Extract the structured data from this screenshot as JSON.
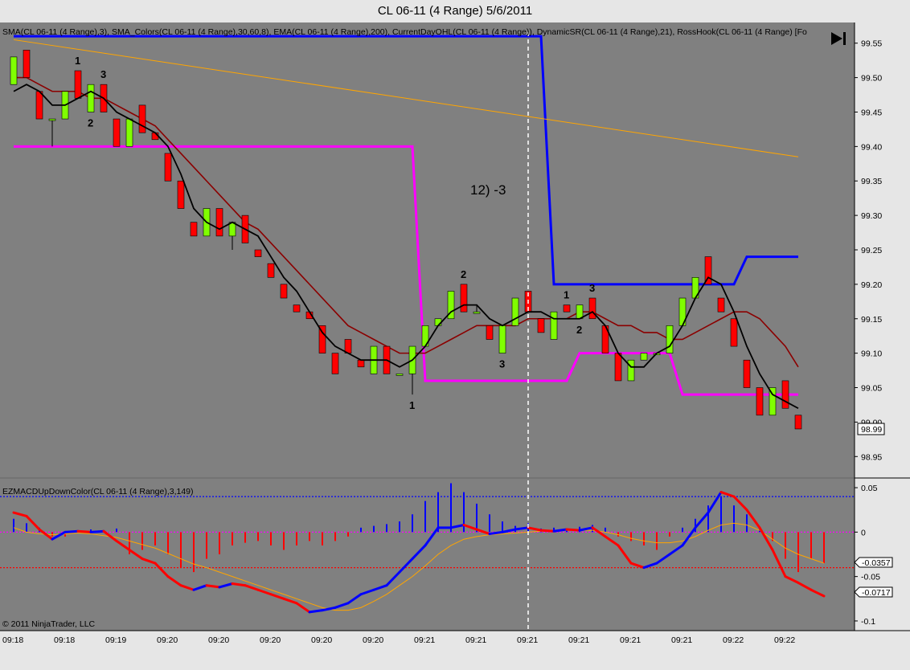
{
  "window": {
    "title": "CL 06-11 (4 Range)  5/6/2011",
    "copyright": "© 2011 NinjaTrader, LLC"
  },
  "price_panel": {
    "indicator_label": "SMA(CL 06-11 (4 Range),3), SMA_Colors(CL 06-11 (4 Range),30,60,8), EMA(CL 06-11 (4 Range),200), CurrentDayOHL(CL 06-11 (4 Range)), DynamicSR(CL 06-11 (4 Range),21), RossHook(CL 06-11 (4 Range) [Fo",
    "annotation": "12) -3",
    "last_price_label": "98.99"
  },
  "macd_panel": {
    "indicator_label": "EZMACDUpDownColor(CL 06-11 (4 Range),3,149)",
    "value_labels": [
      "-0.0357",
      "-0.0717"
    ]
  },
  "colors": {
    "background": "#808080",
    "up_candle": "#80ff00",
    "down_candle": "#ff0000",
    "sma3": "#000000",
    "ema200": "#ffa500",
    "current_day_high": "#0000ff",
    "current_day_low": "#ff00ff",
    "sma_colors_slow": "#8b0000",
    "sma_colors_fast": "#ff0000",
    "sma_colors_flat": "#ffffff",
    "sma_colors_up": "#008000",
    "macd": "#ff0000",
    "macd_up": "#0000ff",
    "signal": "#ffa500"
  },
  "chart_data": [
    {
      "type": "candlestick",
      "ylim": [
        98.92,
        99.58
      ],
      "y_ticks": [
        98.95,
        99.0,
        99.05,
        99.1,
        99.15,
        99.2,
        99.25,
        99.3,
        99.35,
        99.4,
        99.45,
        99.5,
        99.55
      ],
      "x_tick_labels": [
        "09:18",
        "09:18",
        "09:19",
        "09:20",
        "09:20",
        "09:20",
        "09:20",
        "09:20",
        "09:21",
        "09:21",
        "09:21",
        "09:21",
        "09:21",
        "09:21",
        "09:22",
        "09:22"
      ],
      "candles": [
        {
          "o": 99.49,
          "h": 99.53,
          "l": 99.49,
          "c": 99.53
        },
        {
          "o": 99.54,
          "h": 99.54,
          "l": 99.5,
          "c": 99.5
        },
        {
          "o": 99.48,
          "h": 99.48,
          "l": 99.44,
          "c": 99.44
        },
        {
          "o": 99.44,
          "h": 99.44,
          "l": 99.4,
          "c": 99.44
        },
        {
          "o": 99.44,
          "h": 99.48,
          "l": 99.44,
          "c": 99.48
        },
        {
          "o": 99.51,
          "h": 99.51,
          "l": 99.47,
          "c": 99.47
        },
        {
          "o": 99.45,
          "h": 99.49,
          "l": 99.45,
          "c": 99.49
        },
        {
          "o": 99.49,
          "h": 99.49,
          "l": 99.45,
          "c": 99.45
        },
        {
          "o": 99.44,
          "h": 99.44,
          "l": 99.4,
          "c": 99.4
        },
        {
          "o": 99.4,
          "h": 99.44,
          "l": 99.4,
          "c": 99.44
        },
        {
          "o": 99.46,
          "h": 99.46,
          "l": 99.42,
          "c": 99.42
        },
        {
          "o": 99.42,
          "h": 99.42,
          "l": 99.41,
          "c": 99.41
        },
        {
          "o": 99.39,
          "h": 99.39,
          "l": 99.35,
          "c": 99.35
        },
        {
          "o": 99.35,
          "h": 99.35,
          "l": 99.31,
          "c": 99.31
        },
        {
          "o": 99.29,
          "h": 99.29,
          "l": 99.27,
          "c": 99.27
        },
        {
          "o": 99.27,
          "h": 99.31,
          "l": 99.27,
          "c": 99.31
        },
        {
          "o": 99.31,
          "h": 99.31,
          "l": 99.27,
          "c": 99.27
        },
        {
          "o": 99.27,
          "h": 99.29,
          "l": 99.25,
          "c": 99.29
        },
        {
          "o": 99.3,
          "h": 99.3,
          "l": 99.26,
          "c": 99.26
        },
        {
          "o": 99.25,
          "h": 99.25,
          "l": 99.24,
          "c": 99.24
        },
        {
          "o": 99.23,
          "h": 99.23,
          "l": 99.21,
          "c": 99.21
        },
        {
          "o": 99.2,
          "h": 99.2,
          "l": 99.18,
          "c": 99.18
        },
        {
          "o": 99.17,
          "h": 99.17,
          "l": 99.16,
          "c": 99.16
        },
        {
          "o": 99.16,
          "h": 99.16,
          "l": 99.15,
          "c": 99.15
        },
        {
          "o": 99.14,
          "h": 99.14,
          "l": 99.1,
          "c": 99.1
        },
        {
          "o": 99.1,
          "h": 99.1,
          "l": 99.07,
          "c": 99.07
        },
        {
          "o": 99.12,
          "h": 99.12,
          "l": 99.1,
          "c": 99.1
        },
        {
          "o": 99.09,
          "h": 99.09,
          "l": 99.08,
          "c": 99.08
        },
        {
          "o": 99.07,
          "h": 99.11,
          "l": 99.07,
          "c": 99.11
        },
        {
          "o": 99.11,
          "h": 99.11,
          "l": 99.07,
          "c": 99.07
        },
        {
          "o": 99.07,
          "h": 99.07,
          "l": 99.07,
          "c": 99.07
        },
        {
          "o": 99.07,
          "h": 99.11,
          "l": 99.04,
          "c": 99.11
        },
        {
          "o": 99.11,
          "h": 99.14,
          "l": 99.11,
          "c": 99.14
        },
        {
          "o": 99.14,
          "h": 99.15,
          "l": 99.14,
          "c": 99.15
        },
        {
          "o": 99.15,
          "h": 99.19,
          "l": 99.15,
          "c": 99.19
        },
        {
          "o": 99.2,
          "h": 99.2,
          "l": 99.16,
          "c": 99.16
        },
        {
          "o": 99.16,
          "h": 99.17,
          "l": 99.16,
          "c": 99.16
        },
        {
          "o": 99.14,
          "h": 99.14,
          "l": 99.12,
          "c": 99.12
        },
        {
          "o": 99.1,
          "h": 99.14,
          "l": 99.1,
          "c": 99.14
        },
        {
          "o": 99.14,
          "h": 99.18,
          "l": 99.14,
          "c": 99.18
        },
        {
          "o": 99.19,
          "h": 99.19,
          "l": 99.16,
          "c": 99.16
        },
        {
          "o": 99.15,
          "h": 99.15,
          "l": 99.13,
          "c": 99.13
        },
        {
          "o": 99.12,
          "h": 99.16,
          "l": 99.12,
          "c": 99.16
        },
        {
          "o": 99.17,
          "h": 99.17,
          "l": 99.16,
          "c": 99.16
        },
        {
          "o": 99.15,
          "h": 99.17,
          "l": 99.15,
          "c": 99.17
        },
        {
          "o": 99.18,
          "h": 99.18,
          "l": 99.15,
          "c": 99.15
        },
        {
          "o": 99.14,
          "h": 99.14,
          "l": 99.1,
          "c": 99.1
        },
        {
          "o": 99.1,
          "h": 99.1,
          "l": 99.06,
          "c": 99.06
        },
        {
          "o": 99.06,
          "h": 99.09,
          "l": 99.06,
          "c": 99.09
        },
        {
          "o": 99.09,
          "h": 99.1,
          "l": 99.09,
          "c": 99.1
        },
        {
          "o": 99.1,
          "h": 99.1,
          "l": 99.1,
          "c": 99.1
        },
        {
          "o": 99.1,
          "h": 99.14,
          "l": 99.1,
          "c": 99.14
        },
        {
          "o": 99.14,
          "h": 99.18,
          "l": 99.14,
          "c": 99.18
        },
        {
          "o": 99.18,
          "h": 99.21,
          "l": 99.18,
          "c": 99.21
        },
        {
          "o": 99.24,
          "h": 99.24,
          "l": 99.2,
          "c": 99.2
        },
        {
          "o": 99.18,
          "h": 99.18,
          "l": 99.16,
          "c": 99.16
        },
        {
          "o": 99.15,
          "h": 99.15,
          "l": 99.11,
          "c": 99.11
        },
        {
          "o": 99.09,
          "h": 99.09,
          "l": 99.05,
          "c": 99.05
        },
        {
          "o": 99.05,
          "h": 99.05,
          "l": 99.01,
          "c": 99.01
        },
        {
          "o": 99.01,
          "h": 99.05,
          "l": 99.01,
          "c": 99.05
        },
        {
          "o": 99.06,
          "h": 99.06,
          "l": 99.02,
          "c": 99.02
        },
        {
          "o": 99.01,
          "h": 99.01,
          "l": 98.99,
          "c": 98.99
        }
      ],
      "series": [
        {
          "name": "SMA(CL 06-11 (4 Range),3)",
          "values": [
            99.48,
            99.49,
            99.48,
            99.46,
            99.46,
            99.47,
            99.48,
            99.47,
            99.45,
            99.44,
            99.43,
            99.42,
            99.4,
            99.36,
            99.31,
            99.29,
            99.28,
            99.29,
            99.28,
            99.27,
            99.24,
            99.21,
            99.19,
            99.16,
            99.13,
            99.11,
            99.1,
            99.09,
            99.09,
            99.09,
            99.08,
            99.09,
            99.11,
            99.14,
            99.16,
            99.17,
            99.17,
            99.15,
            99.14,
            99.15,
            99.16,
            99.16,
            99.15,
            99.15,
            99.15,
            99.16,
            99.14,
            99.1,
            99.08,
            99.08,
            99.1,
            99.11,
            99.14,
            99.18,
            99.21,
            99.2,
            99.16,
            99.11,
            99.07,
            99.04,
            99.03,
            99.02
          ]
        },
        {
          "name": "EMA(CL 06-11 (4 Range),200)",
          "x_end": 61,
          "values_start": 99.555,
          "values_end": 99.385
        },
        {
          "name": "SMA_Colors slow",
          "values": [
            99.5,
            99.5,
            99.49,
            99.48,
            99.48,
            99.48,
            99.47,
            99.47,
            99.46,
            99.45,
            99.44,
            99.43,
            99.41,
            99.39,
            99.37,
            99.35,
            99.33,
            99.31,
            99.29,
            99.28,
            99.26,
            99.24,
            99.22,
            99.2,
            99.18,
            99.16,
            99.14,
            99.13,
            99.12,
            99.11,
            99.1,
            99.1,
            99.1,
            99.11,
            99.12,
            99.13,
            99.14,
            99.14,
            99.14,
            99.14,
            99.15,
            99.15,
            99.15,
            99.15,
            99.16,
            99.16,
            99.15,
            99.14,
            99.14,
            99.13,
            99.13,
            99.12,
            99.12,
            99.13,
            99.14,
            99.15,
            99.16,
            99.16,
            99.15,
            99.13,
            99.11,
            99.08
          ]
        },
        {
          "name": "CurrentDayOHL high",
          "segments": [
            [
              0,
              99.56
            ],
            [
              40,
              99.56
            ],
            [
              41,
              99.56
            ],
            [
              42,
              99.2
            ],
            [
              56,
              99.2
            ],
            [
              57,
              99.24
            ],
            [
              61,
              99.24
            ]
          ]
        },
        {
          "name": "CurrentDayOHL low",
          "segments": [
            [
              0,
              99.4
            ],
            [
              31,
              99.4
            ],
            [
              32,
              99.06
            ],
            [
              42,
              99.06
            ],
            [
              43,
              99.06
            ],
            [
              44,
              99.1
            ],
            [
              51,
              99.1
            ],
            [
              52,
              99.04
            ],
            [
              61,
              99.04
            ]
          ]
        }
      ],
      "swing_labels": [
        {
          "bar": 5,
          "text": "1",
          "pos": "above"
        },
        {
          "bar": 7,
          "text": "3",
          "pos": "above"
        },
        {
          "bar": 6,
          "text": "2",
          "pos": "below"
        },
        {
          "bar": 31,
          "text": "1",
          "pos": "below"
        },
        {
          "bar": 35,
          "text": "2",
          "pos": "above"
        },
        {
          "bar": 38,
          "text": "3",
          "pos": "below"
        },
        {
          "bar": 43,
          "text": "1",
          "pos": "above"
        },
        {
          "bar": 45,
          "text": "3",
          "pos": "above"
        },
        {
          "bar": 44,
          "text": "2",
          "pos": "below"
        }
      ]
    },
    {
      "type": "bar+line",
      "ylim": [
        -0.11,
        0.06
      ],
      "y_ticks": [
        0.05,
        0,
        -0.05,
        -0.1
      ],
      "y_tick_labels": [
        "0.05",
        "0",
        "-0.05",
        "-0.1"
      ],
      "hlines": [
        {
          "value": 0.04,
          "color": "#0000ff"
        },
        {
          "value": 0.0,
          "color": "#ff00ff"
        },
        {
          "value": -0.04,
          "color": "#ff0000"
        }
      ],
      "histogram": [
        0.015,
        0.01,
        0.005,
        -0.005,
        -0.005,
        0.002,
        0.003,
        0.002,
        0.004,
        -0.025,
        -0.02,
        -0.015,
        -0.025,
        -0.04,
        -0.045,
        -0.03,
        -0.025,
        -0.015,
        -0.012,
        -0.01,
        -0.015,
        -0.02,
        -0.015,
        -0.01,
        -0.015,
        -0.01,
        -0.005,
        0.005,
        0.007,
        0.009,
        0.012,
        0.02,
        0.035,
        0.045,
        0.055,
        0.045,
        0.032,
        0.02,
        0.012,
        0.007,
        0.01,
        0.004,
        0.005,
        0.003,
        0.006,
        0.008,
        0.005,
        -0.005,
        -0.01,
        -0.015,
        -0.02,
        -0.005,
        0.005,
        0.015,
        0.03,
        0.04,
        0.03,
        0.02,
        0.005,
        -0.01,
        -0.03,
        -0.045,
        -0.03,
        -0.035
      ],
      "macd": [
        0.022,
        0.018,
        0.003,
        -0.008,
        0.0,
        0.001,
        0.0,
        0.001,
        -0.01,
        -0.02,
        -0.03,
        -0.035,
        -0.05,
        -0.06,
        -0.065,
        -0.06,
        -0.062,
        -0.058,
        -0.06,
        -0.065,
        -0.07,
        -0.075,
        -0.08,
        -0.09,
        -0.088,
        -0.085,
        -0.08,
        -0.07,
        -0.065,
        -0.06,
        -0.045,
        -0.03,
        -0.015,
        0.005,
        0.005,
        0.008,
        0.003,
        -0.002,
        0.0,
        0.003,
        0.005,
        0.002,
        0.001,
        0.003,
        0.002,
        0.005,
        -0.005,
        -0.015,
        -0.035,
        -0.04,
        -0.035,
        -0.025,
        -0.015,
        0.005,
        0.022,
        0.045,
        0.04,
        0.025,
        0.005,
        -0.02,
        -0.05,
        -0.057,
        -0.065,
        -0.072
      ],
      "signal": [
        0.005,
        0.0,
        -0.002,
        -0.003,
        -0.002,
        -0.001,
        -0.002,
        -0.004,
        -0.006,
        -0.01,
        -0.014,
        -0.018,
        -0.024,
        -0.03,
        -0.036,
        -0.04,
        -0.045,
        -0.05,
        -0.055,
        -0.06,
        -0.065,
        -0.07,
        -0.075,
        -0.08,
        -0.085,
        -0.088,
        -0.088,
        -0.085,
        -0.078,
        -0.07,
        -0.06,
        -0.05,
        -0.038,
        -0.025,
        -0.015,
        -0.008,
        -0.005,
        -0.003,
        -0.002,
        -0.001,
        0.0,
        0.001,
        0.001,
        0.002,
        0.002,
        0.002,
        0.0,
        -0.003,
        -0.007,
        -0.01,
        -0.012,
        -0.012,
        -0.01,
        -0.005,
        0.002,
        0.008,
        0.01,
        0.008,
        0.002,
        -0.008,
        -0.018,
        -0.025,
        -0.03,
        -0.035
      ]
    }
  ]
}
